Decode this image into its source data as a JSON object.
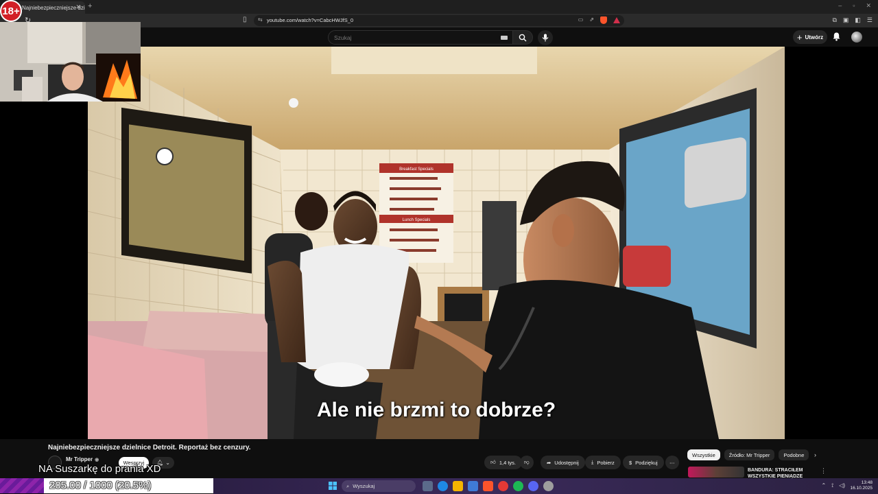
{
  "browser": {
    "tab_title": "Najniebezpieczniejsze dzielnice",
    "url": "youtube.com/watch?v=CabcHWJfS_0"
  },
  "overlay": {
    "age_badge": "18+",
    "donation_message": "NA Suszarkę do prania XD",
    "goal_text": "205.00 / 1000 (20.5%)",
    "goal_progress": 0.205,
    "goal_fill_color": "#8e24aa"
  },
  "youtube": {
    "search_placeholder": "Szukaj",
    "create_label": "Utwórz",
    "subtitle": "Ale nie brzmi to dobrze?",
    "video_title": "Najniebezpieczniejsze dzielnice Detroit. Reportaż bez cenzury.",
    "channel_name": "Mr Tripper",
    "support_label": "Wesprzyj",
    "likes": "1,4 tys.",
    "share_label": "Udostępnij",
    "download_label": "Pobierz",
    "thanks_label": "Podziękuj",
    "chips": [
      "Wszystkie",
      "Źródło: Mr Tripper",
      "Podobne"
    ],
    "reco_title_line1": "BANDURA: STRACIŁEM",
    "reco_title_line2": "WSZYSTKIE PIENIĄDZE"
  },
  "taskbar": {
    "search_placeholder": "Wyszukaj",
    "time": "13:48",
    "date": "16.10.2025"
  },
  "colors": {
    "brand_red": "#d21f26",
    "brave_orange": "#fb542b"
  }
}
